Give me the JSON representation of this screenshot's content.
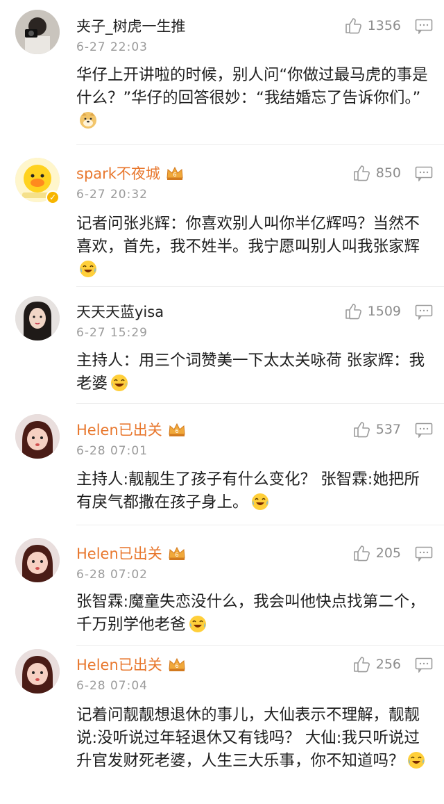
{
  "comments": [
    {
      "username": "夹子_树虎一生推",
      "time": "6-27 22:03",
      "likes": "1356",
      "text": "华仔上开讲啦的时候，别人问“你做过最马虎的事是什么？”华仔的回答很妙：“我结婚忘了告诉你们。”",
      "emoji": "doge-emoji",
      "vip": false
    },
    {
      "username": "spark不夜城",
      "time": "6-27 20:32",
      "likes": "850",
      "text": "记者问张兆辉：你喜欢别人叫你半亿辉吗？当然不喜欢，首先，我不姓半。我宁愿叫别人叫我张家辉",
      "emoji": "laugh-cry-emoji",
      "vip": true
    },
    {
      "username": "天天天蓝yisa",
      "time": "6-27 15:29",
      "likes": "1509",
      "text": "主持人：用三个词赞美一下太太关咏荷 张家辉：我老婆",
      "emoji": "laugh-emoji",
      "vip": false
    },
    {
      "username": "Helen已出关",
      "time": "6-28 07:01",
      "likes": "537",
      "text": "主持人:靓靓生了孩子有什么变化？ 张智霖:她把所有戾气都撒在孩子身上。",
      "emoji": "laugh-cry-emoji",
      "vip": true
    },
    {
      "username": "Helen已出关",
      "time": "6-28 07:02",
      "likes": "205",
      "text": "张智霖:魔童失恋没什么，我会叫他快点找第二个，千万别学他老爸",
      "emoji": "laugh-cry-emoji",
      "vip": true
    },
    {
      "username": "Helen已出关",
      "time": "6-28 07:04",
      "likes": "256",
      "text": "记着问靓靓想退休的事儿，大仙表示不理解，靓靓说:没听说过年轻退休又有钱吗？ 大仙:我只听说过升官发财死老婆，人生三大乐事，你不知道吗？",
      "emoji": "laugh-cry-emoji",
      "vip": true
    }
  ],
  "colors": {
    "vip_name": "#e8772d",
    "meta": "#9b9b9b",
    "badge": "#f7b500"
  },
  "icons": [
    "thumbs-up-icon",
    "reply-icon",
    "crown-icon",
    "verified-badge"
  ]
}
